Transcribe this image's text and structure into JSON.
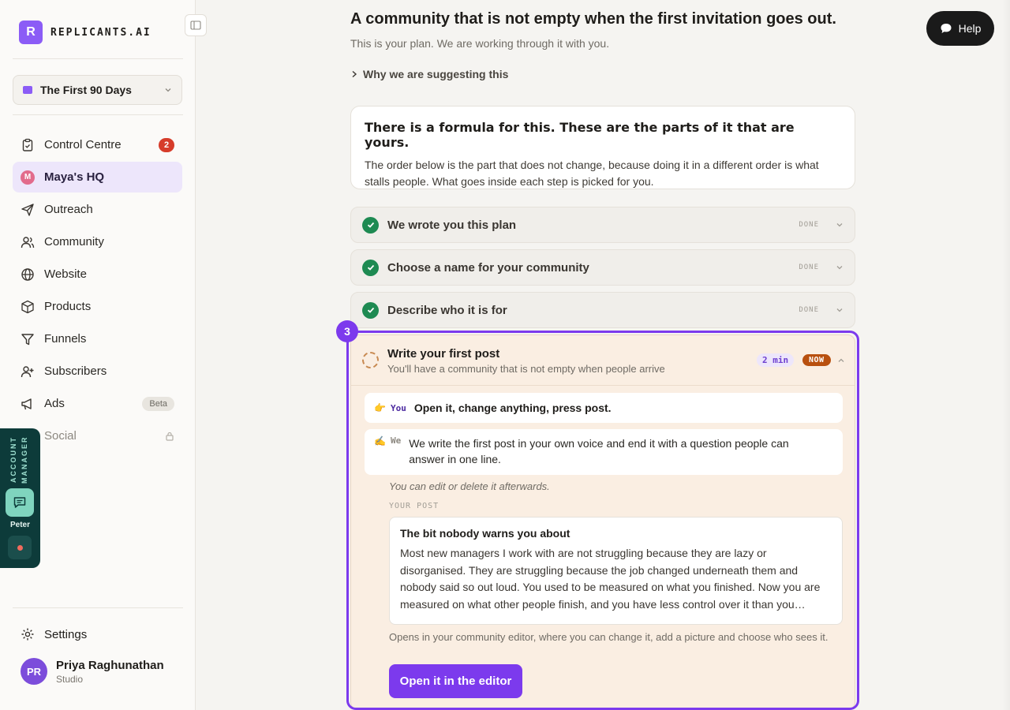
{
  "brand": {
    "logo_letter": "R",
    "name": "REPLICANTS.AI"
  },
  "project": {
    "label": "The First 90 Days"
  },
  "nav": {
    "items": [
      {
        "label": "Control Centre",
        "icon": "clipboard-icon",
        "badge": "2"
      },
      {
        "label": "Maya's HQ",
        "icon": "maya-avatar-icon",
        "avatar_letter": "M"
      },
      {
        "label": "Outreach",
        "icon": "send-icon"
      },
      {
        "label": "Community",
        "icon": "users-icon"
      },
      {
        "label": "Website",
        "icon": "globe-icon"
      },
      {
        "label": "Products",
        "icon": "box-icon"
      },
      {
        "label": "Funnels",
        "icon": "filter-icon"
      },
      {
        "label": "Subscribers",
        "icon": "user-plus-icon"
      },
      {
        "label": "Ads",
        "icon": "megaphone-icon",
        "badge": "Beta"
      },
      {
        "label": "Social",
        "icon": "lock-icon"
      }
    ]
  },
  "settings": {
    "label": "Settings"
  },
  "user": {
    "initials": "PR",
    "name": "Priya Raghunathan",
    "plan": "Studio"
  },
  "account_manager": {
    "title_line1": "ACCOUNT",
    "title_line2": "MANAGER",
    "name": "Peter"
  },
  "help": {
    "label": "Help"
  },
  "page": {
    "title": "A community that is not empty when the first invitation goes out.",
    "subtitle": "This is your plan. We are working through it with you.",
    "why_link": "Why we are suggesting this"
  },
  "formula": {
    "title": "There is a formula for this. These are the parts of it that are yours.",
    "body": "The order below is the part that does not change, because doing it in a different order is what stalls people. What goes inside each step is picked for you."
  },
  "steps": {
    "done_label": "DONE",
    "items": [
      {
        "label": "We wrote you this plan"
      },
      {
        "label": "Choose a name for your community"
      },
      {
        "label": "Describe who it is for"
      }
    ]
  },
  "active_step": {
    "number": "3",
    "title": "Write your first post",
    "subtitle": "You'll have a community that is not empty when people arrive",
    "time": "2 min",
    "status": "NOW",
    "you": {
      "emoji": "👉",
      "tag": "You",
      "text": "Open it, change anything, press post."
    },
    "we": {
      "emoji": "✍️",
      "tag": "We",
      "text": "We write the first post in your own voice and end it with a question people can answer in one line."
    },
    "edit_note": "You can edit or delete it afterwards.",
    "post_label": "YOUR POST",
    "post_title": "The bit nobody warns you about",
    "post_body": "Most new managers I work with are not struggling because they are lazy or disorganised. They are struggling because the job changed underneath them and nobody said so out loud. You used to be measured on what you finished. Now you are measured on what other people finish, and you have less control over it than you…",
    "opens_note": "Opens in your community editor, where you can change it, add a picture and choose who sees it.",
    "button": "Open it in the editor"
  },
  "colors": {
    "accent": "#7c3aed",
    "done_green": "#1e8a52",
    "now_orange": "#b8500f",
    "badge_red": "#d63c2a"
  }
}
